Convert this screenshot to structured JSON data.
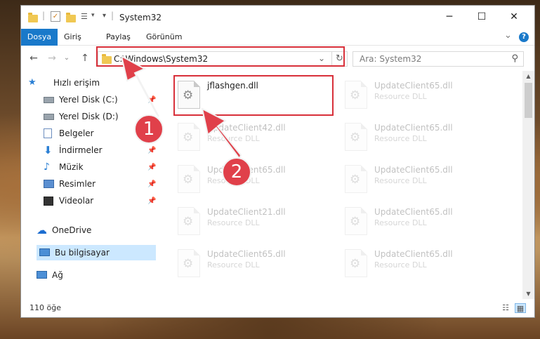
{
  "window": {
    "title": "System32",
    "controls": {
      "minimize": "─",
      "maximize": "☐",
      "close": "✕"
    }
  },
  "ribbon": {
    "tabs": [
      "Dosya",
      "Giriş",
      "Paylaş",
      "Görünüm"
    ],
    "collapse": "⌄",
    "help": "?"
  },
  "address": {
    "path": "C:\\Windows\\System32",
    "dropdown": "⌄",
    "refresh": "↻",
    "search_placeholder": "Ara: System32",
    "nav": {
      "back": "←",
      "forward": "→",
      "recent": "⌄",
      "up": "↑"
    }
  },
  "sidebar": {
    "quick_access": "Hızlı erişim",
    "items": [
      {
        "label": "Yerel Disk (C:)",
        "pinned": true
      },
      {
        "label": "Yerel Disk (D:)",
        "pinned": false
      },
      {
        "label": "Belgeler",
        "pinned": true
      },
      {
        "label": "İndirmeler",
        "pinned": true
      },
      {
        "label": "Müzik",
        "pinned": true
      },
      {
        "label": "Resimler",
        "pinned": true
      },
      {
        "label": "Videolar",
        "pinned": true
      }
    ],
    "onedrive": "OneDrive",
    "this_pc": "Bu bilgisayar",
    "network": "Ağ"
  },
  "files": {
    "highlighted": {
      "name": "jflashgen.dll"
    },
    "rows": [
      [
        {
          "name": "jflashgen.dll",
          "type": ""
        },
        {
          "name": "UpdateClient65.dll",
          "type": "Resource DLL"
        }
      ],
      [
        {
          "name": "UpdateClient42.dll",
          "type": "Resource DLL"
        },
        {
          "name": "UpdateClient65.dll",
          "type": "Resource DLL"
        }
      ],
      [
        {
          "name": "UpdateClient65.dll",
          "type": "Resource DLL"
        },
        {
          "name": "UpdateClient65.dll",
          "type": "Resource DLL"
        }
      ],
      [
        {
          "name": "UpdateClient21.dll",
          "type": "Resource DLL"
        },
        {
          "name": "UpdateClient65.dll",
          "type": "Resource DLL"
        }
      ],
      [
        {
          "name": "UpdateClient65.dll",
          "type": "Resource DLL"
        },
        {
          "name": "UpdateClient65.dll",
          "type": "Resource DLL"
        }
      ]
    ]
  },
  "status": {
    "item_count": "110 öğe"
  },
  "annotations": {
    "step1": "1",
    "step2": "2",
    "color": "#d8303a"
  }
}
